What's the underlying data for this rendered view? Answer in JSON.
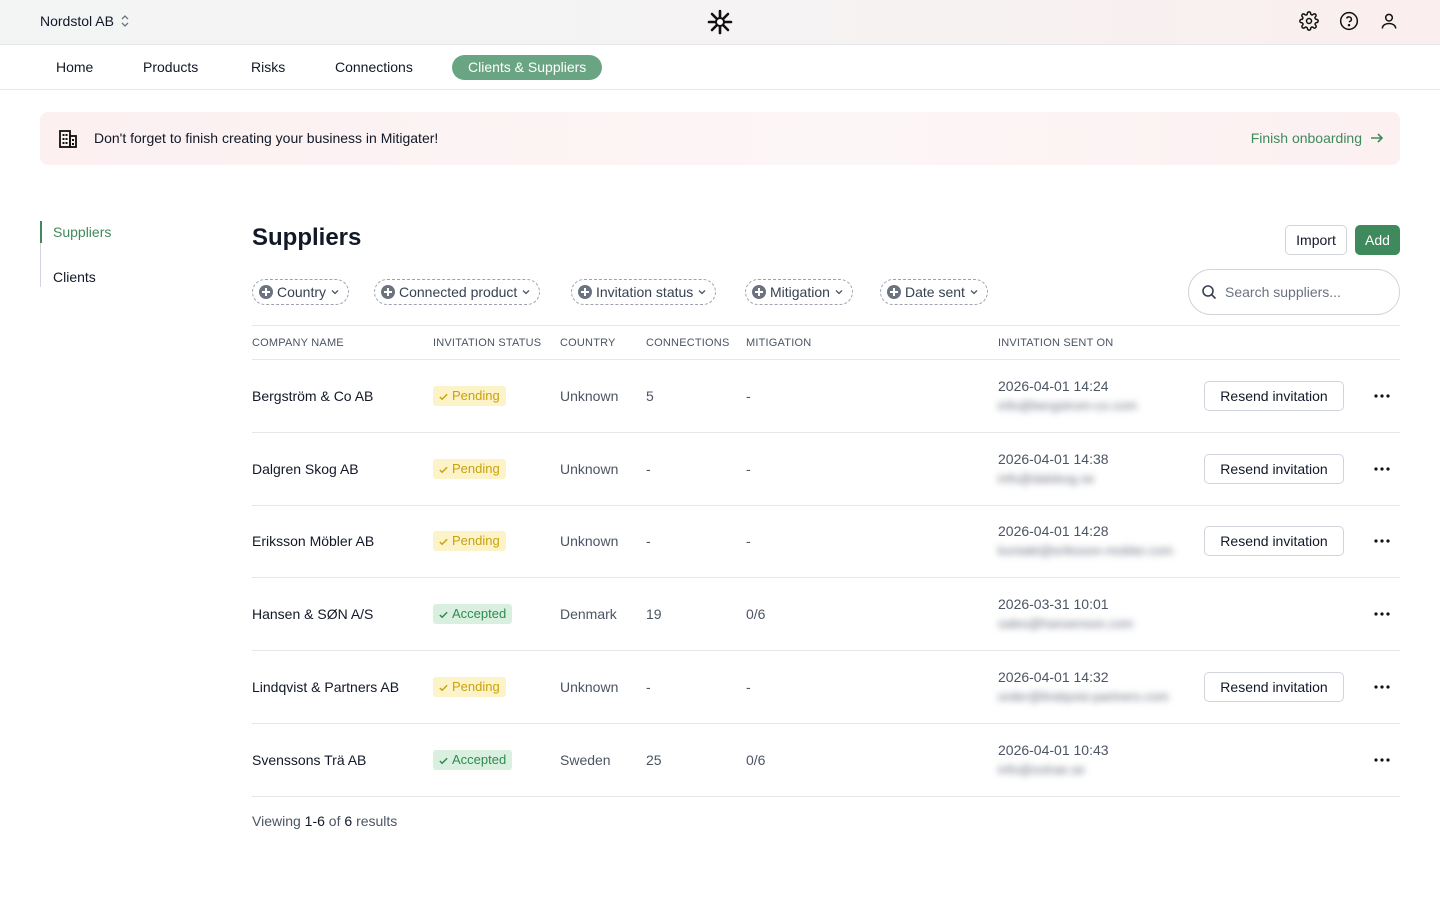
{
  "header": {
    "org_name": "Nordstol AB"
  },
  "nav": {
    "tabs": [
      {
        "label": "Home"
      },
      {
        "label": "Products"
      },
      {
        "label": "Risks"
      },
      {
        "label": "Connections"
      },
      {
        "label": "Clients & Suppliers",
        "active": true
      }
    ]
  },
  "banner": {
    "text": "Don't forget to finish creating your business in Mitigater!",
    "link": "Finish onboarding"
  },
  "side": {
    "items": [
      {
        "label": "Suppliers",
        "active": true
      },
      {
        "label": "Clients"
      }
    ]
  },
  "main": {
    "title": "Suppliers",
    "import_label": "Import",
    "add_label": "Add",
    "filters": [
      "Country",
      "Connected product",
      "Invitation status",
      "Mitigation",
      "Date sent"
    ],
    "search_placeholder": "Search suppliers..."
  },
  "table": {
    "columns": [
      "COMPANY NAME",
      "INVITATION STATUS",
      "COUNTRY",
      "CONNECTIONS",
      "MITIGATION",
      "INVITATION SENT ON"
    ],
    "resend_label": "Resend invitation",
    "rows": [
      {
        "name": "Bergström & Co AB",
        "status": "Pending",
        "country": "Unknown",
        "connections": "5",
        "mitigation": "-",
        "sent_on": "2026-04-01 14:24",
        "email": "info@bergstrom-co.com",
        "resend": true
      },
      {
        "name": "Dalgren Skog AB",
        "status": "Pending",
        "country": "Unknown",
        "connections": "-",
        "mitigation": "-",
        "sent_on": "2026-04-01 14:38",
        "email": "info@dalskog.se",
        "resend": true
      },
      {
        "name": "Eriksson Möbler AB",
        "status": "Pending",
        "country": "Unknown",
        "connections": "-",
        "mitigation": "-",
        "sent_on": "2026-04-01 14:28",
        "email": "kontakt@eriksson-mobler.com",
        "resend": true
      },
      {
        "name": "Hansen & SØN A/S",
        "status": "Accepted",
        "country": "Denmark",
        "connections": "19",
        "mitigation": "0/6",
        "sent_on": "2026-03-31 10:01",
        "email": "sales@hansenson.com",
        "resend": false
      },
      {
        "name": "Lindqvist & Partners AB",
        "status": "Pending",
        "country": "Unknown",
        "connections": "-",
        "mitigation": "-",
        "sent_on": "2026-04-01 14:32",
        "email": "order@lindqvist-partners.com",
        "resend": true
      },
      {
        "name": "Svenssons Trä AB",
        "status": "Accepted",
        "country": "Sweden",
        "connections": "25",
        "mitigation": "0/6",
        "sent_on": "2026-04-01 10:43",
        "email": "info@svtrae.se",
        "resend": false
      }
    ]
  },
  "footer": {
    "prefix": "Viewing",
    "range": "1-6",
    "of": "of",
    "total": "6",
    "suffix": "results"
  },
  "colors": {
    "brand_green": "#3f8a5c",
    "active_tab": "#6aa583",
    "pending_bg": "#fdf3c8",
    "pending_fg": "#c9a20d",
    "accepted_bg": "#d9f0e0",
    "accepted_fg": "#2f8a4e"
  }
}
